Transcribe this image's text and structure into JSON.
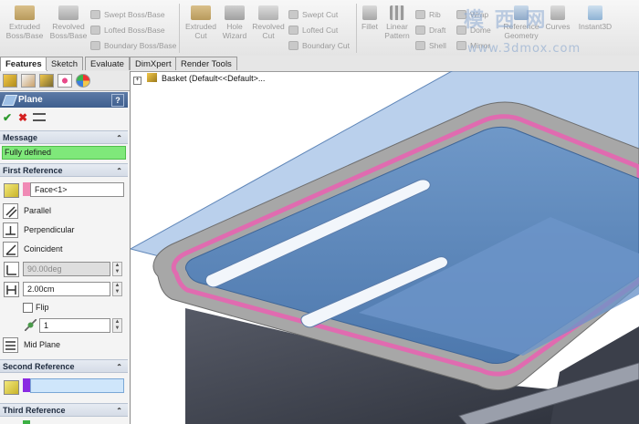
{
  "ribbon": {
    "buttons": [
      {
        "label": "Extruded\nBoss/Base"
      },
      {
        "label": "Revolved\nBoss/Base"
      },
      {
        "label": "Extruded\nCut"
      },
      {
        "label": "Hole\nWizard"
      },
      {
        "label": "Revolved\nCut"
      },
      {
        "label": "Fillet"
      },
      {
        "label": "Linear\nPattern"
      },
      {
        "label": "Reference\nGeometry"
      },
      {
        "label": "Curves"
      },
      {
        "label": "Instant3D"
      }
    ],
    "small": [
      {
        "label": "Swept Boss/Base"
      },
      {
        "label": "Lofted Boss/Base"
      },
      {
        "label": "Boundary Boss/Base"
      },
      {
        "label": "Swept Cut"
      },
      {
        "label": "Lofted Cut"
      },
      {
        "label": "Boundary Cut"
      },
      {
        "label": "Rib"
      },
      {
        "label": "Draft"
      },
      {
        "label": "Shell"
      },
      {
        "label": "Wrap"
      },
      {
        "label": "Dome"
      },
      {
        "label": "Mirror"
      }
    ]
  },
  "watermark": {
    "line1": "模 西 网",
    "line2": "www.3dmox.com"
  },
  "tabs": [
    "Features",
    "Sketch",
    "Evaluate",
    "DimXpert",
    "Render Tools"
  ],
  "pm": {
    "title": "Plane",
    "help": "?",
    "message_header": "Message",
    "message": "Fully defined",
    "first_ref_header": "First Reference",
    "first_ref_value": "Face<1>",
    "options": [
      "Parallel",
      "Perpendicular",
      "Coincident"
    ],
    "angle": "90.00deg",
    "distance": "2.00cm",
    "flip": "Flip",
    "count": "1",
    "mid_plane": "Mid Plane",
    "second_ref_header": "Second Reference",
    "third_ref_header": "Third Reference",
    "colors": {
      "first": "#f08ab5",
      "second": "#8a2be2",
      "third": "#3cb044"
    }
  },
  "tree": {
    "label": "Basket  (Default<<Default>..."
  },
  "symbols": {
    "collapse": "⌃",
    "expand": "+",
    "spin_up": "▲",
    "spin_down": "▼",
    "ok": "✔",
    "cancel": "✖"
  }
}
